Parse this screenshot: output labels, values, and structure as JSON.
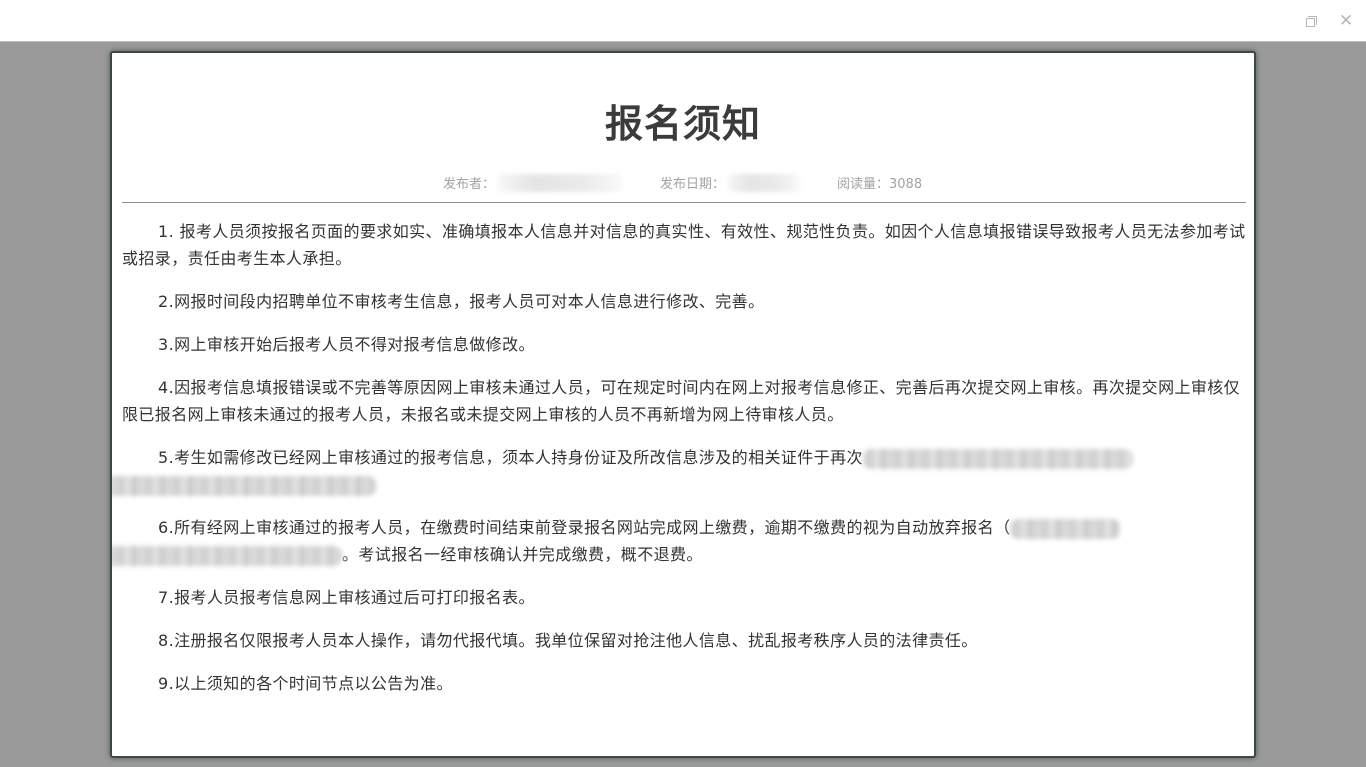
{
  "window": {
    "restore_icon": "restore-icon",
    "close_label": "✕"
  },
  "notice": {
    "title": "报名须知",
    "publisher_label": "发布者：",
    "date_label": "发布日期：",
    "views_label": "阅读量：3088",
    "paragraphs": [
      "1. 报考人员须按报名页面的要求如实、准确填报本人信息并对信息的真实性、有效性、规范性负责。如因个人信息填报错误导致报考人员无法参加考试或招录，责任由考生本人承担。",
      "2.网报时间段内招聘单位不审核考生信息，报考人员可对本人信息进行修改、完善。",
      "3.网上审核开始后报考人员不得对报考信息做修改。",
      "4.因报考信息填报错误或不完善等原因网上审核未通过人员，可在规定时间内在网上对报考信息修正、完善后再次提交网上审核。再次提交网上审核仅限已报名网上审核未通过的报考人员，未报名或未提交网上审核的人员不再新增为网上待审核人员。",
      "5.考生如需修改已经网上审核通过的报考信息，须本人持身份证及所改信息涉及的相关证件于再次",
      "6.所有经网上审核通过的报考人员，在缴费时间结束前登录报名网站完成网上缴费，逾期不缴费的视为自动放弃报名（",
      "。考试报名一经审核确认并完成缴费，概不退费。",
      "7.报考人员报考信息网上审核通过后可打印报名表。",
      "8.注册报名仅限报考人员本人操作，请勿代报代填。我单位保留对抢注他人信息、扰乱报考秩序人员的法律责任。",
      "9.以上须知的各个时间节点以公告为准。"
    ]
  }
}
